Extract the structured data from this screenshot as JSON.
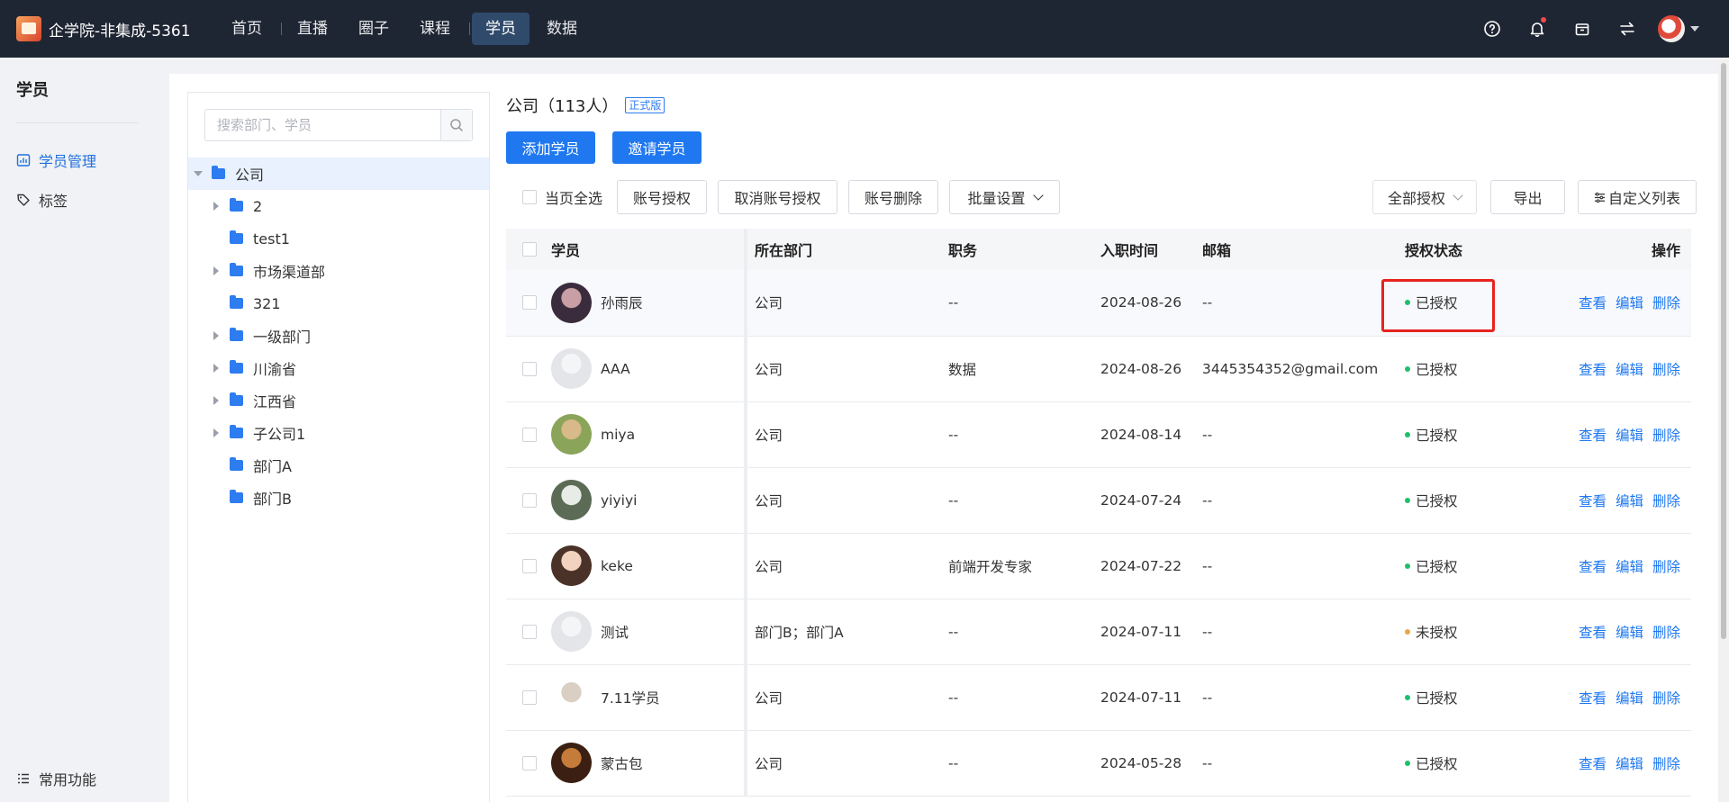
{
  "app": {
    "title": "企学院-非集成-5361",
    "nav": [
      "首页",
      "直播",
      "圈子",
      "课程",
      "学员",
      "数据"
    ],
    "active_nav_index": 4,
    "icons": [
      "help-icon",
      "bell-icon",
      "store-icon",
      "switch-icon",
      "avatar"
    ]
  },
  "sidebar": {
    "title": "学员",
    "items": [
      {
        "label": "学员管理",
        "icon": "chart-icon",
        "active": true
      },
      {
        "label": "标签",
        "icon": "tag-icon",
        "active": false
      }
    ],
    "bottom_label": "常用功能"
  },
  "tree": {
    "search_placeholder": "搜索部门、学员",
    "nodes": [
      {
        "label": "公司",
        "level": 0,
        "expanded": true,
        "selected": true,
        "has_children": true
      },
      {
        "label": "2",
        "level": 1,
        "has_children": true
      },
      {
        "label": "test1",
        "level": 1,
        "has_children": false
      },
      {
        "label": "市场渠道部",
        "level": 1,
        "has_children": true
      },
      {
        "label": "321",
        "level": 1,
        "has_children": false
      },
      {
        "label": "一级部门",
        "level": 1,
        "has_children": true
      },
      {
        "label": "川渝省",
        "level": 1,
        "has_children": true
      },
      {
        "label": "江西省",
        "level": 1,
        "has_children": true
      },
      {
        "label": "子公司1",
        "level": 1,
        "has_children": true
      },
      {
        "label": "部门A",
        "level": 1,
        "has_children": false
      },
      {
        "label": "部门B",
        "level": 1,
        "has_children": false
      }
    ]
  },
  "main": {
    "title": "公司（113人）",
    "edition_badge": "正式版",
    "add_button": "添加学员",
    "invite_button": "邀请学员",
    "select_all_label": "当页全选",
    "toolbar_buttons": [
      "账号授权",
      "取消账号授权",
      "账号删除",
      "批量设置"
    ],
    "auth_filter": "全部授权",
    "export_button": "导出",
    "custom_columns_button": "自定义列表",
    "columns": [
      "学员",
      "所在部门",
      "职务",
      "入职时间",
      "邮箱",
      "授权状态",
      "操作"
    ],
    "row_actions": [
      "查看",
      "编辑",
      "删除"
    ],
    "rows": [
      {
        "name": "孙雨辰",
        "dept": "公司",
        "job": "--",
        "date": "2024-08-26",
        "email": "--",
        "status": "已授权",
        "authorized": true,
        "avatar_colors": [
          "#3a2b3d",
          "#c79fa4"
        ]
      },
      {
        "name": "AAA",
        "dept": "公司",
        "job": "数据",
        "date": "2024-08-26",
        "email": "3445354352@gmail.com",
        "status": "已授权",
        "authorized": true,
        "avatar_colors": [
          "#e3e5e8",
          "#f4f5f6"
        ]
      },
      {
        "name": "miya",
        "dept": "公司",
        "job": "--",
        "date": "2024-08-14",
        "email": "--",
        "status": "已授权",
        "authorized": true,
        "avatar_colors": [
          "#8aa45a",
          "#d7b98a"
        ]
      },
      {
        "name": "yiyiyi",
        "dept": "公司",
        "job": "--",
        "date": "2024-07-24",
        "email": "--",
        "status": "已授权",
        "authorized": true,
        "avatar_colors": [
          "#5b6b55",
          "#e8ece6"
        ]
      },
      {
        "name": "keke",
        "dept": "公司",
        "job": "前端开发专家",
        "date": "2024-07-22",
        "email": "--",
        "status": "已授权",
        "authorized": true,
        "avatar_colors": [
          "#4a3228",
          "#f1d3bf"
        ]
      },
      {
        "name": "测试",
        "dept": "部门B；部门A",
        "job": "--",
        "date": "2024-07-11",
        "email": "--",
        "status": "未授权",
        "authorized": false,
        "avatar_colors": [
          "#e3e5e8",
          "#f4f5f6"
        ]
      },
      {
        "name": "7.11学员",
        "dept": "公司",
        "job": "--",
        "date": "2024-07-11",
        "email": "--",
        "status": "已授权",
        "authorized": true,
        "avatar_colors": [
          "#ffffff",
          "#d9cfc2"
        ]
      },
      {
        "name": "蒙古包",
        "dept": "公司",
        "job": "--",
        "date": "2024-05-28",
        "email": "--",
        "status": "已授权",
        "authorized": true,
        "avatar_colors": [
          "#3a1f12",
          "#c57b3a"
        ]
      }
    ]
  },
  "colors": {
    "primary": "#1f78f0",
    "topbar": "#1f2633",
    "authorized_dot": "#1fbf6b",
    "unauthorized_dot": "#e8a64a",
    "annotation_red": "#e8231f"
  }
}
